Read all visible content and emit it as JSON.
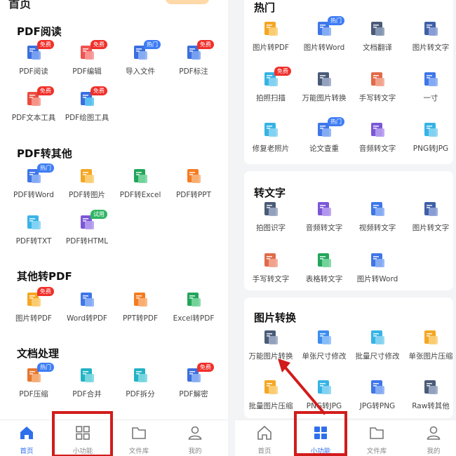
{
  "colors": {
    "accent": "#2f6fec",
    "free_badge": "#f0302b",
    "hot_badge": "#3d7cf5",
    "trial_badge": "#2fb562",
    "highlight": "#d21b1b"
  },
  "left": {
    "header_title": "首页",
    "sections": [
      {
        "title": "PDF阅读",
        "items": [
          {
            "label": "PDF阅读",
            "badge": "免费",
            "icon": "book-icon"
          },
          {
            "label": "PDF编辑",
            "badge": "免费",
            "icon": "edit-doc-icon"
          },
          {
            "label": "导入文件",
            "badge": "热门",
            "icon": "import-icon"
          },
          {
            "label": "PDF标注",
            "badge": "免费",
            "icon": "annotate-icon"
          },
          {
            "label": "PDF文本工具",
            "badge": "免费",
            "icon": "text-tool-icon"
          },
          {
            "label": "PDF绘图工具",
            "badge": "免费",
            "icon": "draw-tool-icon"
          }
        ]
      },
      {
        "title": "PDF转其他",
        "items": [
          {
            "label": "PDF转Word",
            "badge": "热门",
            "icon": "word-icon"
          },
          {
            "label": "PDF转图片",
            "badge": "",
            "icon": "image-file-icon"
          },
          {
            "label": "PDF转Excel",
            "badge": "",
            "icon": "excel-icon"
          },
          {
            "label": "PDF转PPT",
            "badge": "",
            "icon": "ppt-icon"
          },
          {
            "label": "PDF转TXT",
            "badge": "",
            "icon": "txt-icon"
          },
          {
            "label": "PDF转HTML",
            "badge": "试用",
            "icon": "html-icon"
          }
        ]
      },
      {
        "title": "其他转PDF",
        "items": [
          {
            "label": "图片转PDF",
            "badge": "免费",
            "icon": "image-to-pdf-icon"
          },
          {
            "label": "Word转PDF",
            "badge": "",
            "icon": "word-icon"
          },
          {
            "label": "PPT转PDF",
            "badge": "",
            "icon": "ppt-icon"
          },
          {
            "label": "Excel转PDF",
            "badge": "",
            "icon": "excel-icon"
          }
        ]
      },
      {
        "title": "文档处理",
        "items": [
          {
            "label": "PDF压缩",
            "badge": "热门",
            "icon": "compress-icon"
          },
          {
            "label": "PDF合并",
            "badge": "",
            "icon": "merge-icon"
          },
          {
            "label": "PDF拆分",
            "badge": "",
            "icon": "split-icon"
          },
          {
            "label": "PDF解密",
            "badge": "免费",
            "icon": "unlock-icon"
          }
        ]
      }
    ]
  },
  "right": {
    "cards": [
      {
        "title": "热门",
        "items": [
          {
            "label": "图片转PDF",
            "badge": "",
            "icon": "image-to-pdf-icon"
          },
          {
            "label": "图片转Word",
            "badge": "热门",
            "icon": "image-to-word-icon"
          },
          {
            "label": "文档翻译",
            "badge": "",
            "icon": "translate-icon"
          },
          {
            "label": "图片转文字",
            "badge": "",
            "icon": "image-to-text-icon"
          },
          {
            "label": "拍照扫描",
            "badge": "免费",
            "icon": "scan-icon"
          },
          {
            "label": "万能图片转换",
            "badge": "",
            "icon": "image-convert-icon"
          },
          {
            "label": "手写转文字",
            "badge": "",
            "icon": "handwriting-icon"
          },
          {
            "label": "一寸",
            "badge": "",
            "icon": "id-photo-icon"
          },
          {
            "label": "修复老照片",
            "badge": "",
            "icon": "photo-restore-icon"
          },
          {
            "label": "论文查重",
            "badge": "热门",
            "icon": "paper-check-icon"
          },
          {
            "label": "音频转文字",
            "badge": "",
            "icon": "audio-to-text-icon"
          },
          {
            "label": "PNG转JPG",
            "badge": "",
            "icon": "png-icon"
          }
        ]
      },
      {
        "title": "转文字",
        "items": [
          {
            "label": "拍图识字",
            "badge": "",
            "icon": "ocr-icon"
          },
          {
            "label": "音频转文字",
            "badge": "",
            "icon": "audio-to-text-icon"
          },
          {
            "label": "视频转文字",
            "badge": "",
            "icon": "video-to-text-icon"
          },
          {
            "label": "图片转文字",
            "badge": "",
            "icon": "image-to-text-icon"
          },
          {
            "label": "手写转文字",
            "badge": "",
            "icon": "handwriting-icon"
          },
          {
            "label": "表格转文字",
            "badge": "",
            "icon": "table-to-text-icon"
          },
          {
            "label": "图片转Word",
            "badge": "",
            "icon": "image-to-word-icon"
          }
        ]
      },
      {
        "title": "图片转换",
        "items": [
          {
            "label": "万能图片转换",
            "badge": "",
            "icon": "image-convert-icon"
          },
          {
            "label": "单张尺寸修改",
            "badge": "",
            "icon": "resize-icon"
          },
          {
            "label": "批量尺寸修改",
            "badge": "",
            "icon": "batch-resize-icon"
          },
          {
            "label": "单张图片压缩",
            "badge": "",
            "icon": "image-compress-icon"
          },
          {
            "label": "批量图片压缩",
            "badge": "",
            "icon": "batch-compress-icon"
          },
          {
            "label": "PNG转JPG",
            "badge": "",
            "icon": "png-icon"
          },
          {
            "label": "JPG转PNG",
            "badge": "",
            "icon": "jpg-icon"
          },
          {
            "label": "Raw转其他",
            "badge": "",
            "icon": "raw-icon"
          }
        ]
      }
    ]
  },
  "nav": [
    {
      "label": "首页",
      "icon": "home-icon"
    },
    {
      "label": "小功能",
      "icon": "grid-icon"
    },
    {
      "label": "文件库",
      "icon": "folder-icon"
    },
    {
      "label": "我的",
      "icon": "user-icon"
    }
  ]
}
